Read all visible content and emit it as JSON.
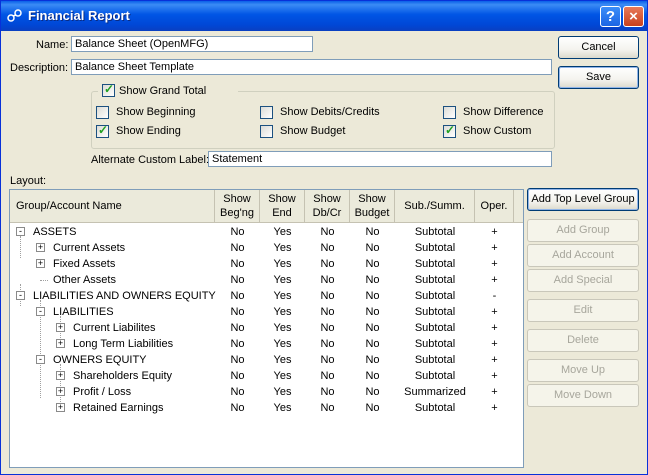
{
  "window": {
    "title": "Financial Report",
    "help_glyph": "?",
    "close_glyph": "×"
  },
  "form": {
    "name_label": "Name:",
    "name_value": "Balance Sheet (OpenMFG)",
    "description_label": "Description:",
    "description_value": "Balance Sheet Template",
    "show_grand_total": "Show Grand Total",
    "show_beginning": "Show Beginning",
    "show_ending": "Show Ending",
    "show_debits_credits": "Show Debits/Credits",
    "show_budget": "Show Budget",
    "show_difference": "Show Difference",
    "show_custom": "Show Custom",
    "alt_custom_label": "Alternate Custom Label:",
    "alt_custom_value": "Statement",
    "layout_label": "Layout:",
    "checked": {
      "show_grand_total": true,
      "show_beginning": false,
      "show_ending": true,
      "show_debits_credits": false,
      "show_budget": false,
      "show_difference": false,
      "show_custom": true
    }
  },
  "buttons": {
    "cancel": "Cancel",
    "save": "Save",
    "add_top_level_group": "Add Top Level Group",
    "add_group": "Add Group",
    "add_account": "Add Account",
    "add_special": "Add Special",
    "edit": "Edit",
    "delete": "Delete",
    "move_up": "Move Up",
    "move_down": "Move Down"
  },
  "table": {
    "columns": [
      {
        "line1": "Group/Account Name",
        "line2": ""
      },
      {
        "line1": "Show",
        "line2": "Beg'ng"
      },
      {
        "line1": "Show",
        "line2": "End"
      },
      {
        "line1": "Show",
        "line2": "Db/Cr"
      },
      {
        "line1": "Show",
        "line2": "Budget"
      },
      {
        "line1": "Sub./Summ.",
        "line2": ""
      },
      {
        "line1": "Oper.",
        "line2": ""
      }
    ],
    "rows": [
      {
        "name": "ASSETS",
        "level": 0,
        "expander": "-",
        "beg": "No",
        "end": "Yes",
        "dbcr": "No",
        "budget": "No",
        "summ": "Subtotal",
        "oper": "+"
      },
      {
        "name": "Current Assets",
        "level": 1,
        "expander": "+",
        "beg": "No",
        "end": "Yes",
        "dbcr": "No",
        "budget": "No",
        "summ": "Subtotal",
        "oper": "+"
      },
      {
        "name": "Fixed Assets",
        "level": 1,
        "expander": "+",
        "beg": "No",
        "end": "Yes",
        "dbcr": "No",
        "budget": "No",
        "summ": "Subtotal",
        "oper": "+"
      },
      {
        "name": "Other Assets",
        "level": 1,
        "expander": "",
        "beg": "No",
        "end": "Yes",
        "dbcr": "No",
        "budget": "No",
        "summ": "Subtotal",
        "oper": "+"
      },
      {
        "name": "LIABILITIES AND OWNERS EQUITY",
        "level": 0,
        "expander": "-",
        "beg": "No",
        "end": "Yes",
        "dbcr": "No",
        "budget": "No",
        "summ": "Subtotal",
        "oper": "-"
      },
      {
        "name": "LIABILITIES",
        "level": 1,
        "expander": "-",
        "beg": "No",
        "end": "Yes",
        "dbcr": "No",
        "budget": "No",
        "summ": "Subtotal",
        "oper": "+"
      },
      {
        "name": "Current Liabilites",
        "level": 2,
        "expander": "+",
        "beg": "No",
        "end": "Yes",
        "dbcr": "No",
        "budget": "No",
        "summ": "Subtotal",
        "oper": "+"
      },
      {
        "name": "Long Term Liabilities",
        "level": 2,
        "expander": "+",
        "beg": "No",
        "end": "Yes",
        "dbcr": "No",
        "budget": "No",
        "summ": "Subtotal",
        "oper": "+"
      },
      {
        "name": "OWNERS EQUITY",
        "level": 1,
        "expander": "-",
        "beg": "No",
        "end": "Yes",
        "dbcr": "No",
        "budget": "No",
        "summ": "Subtotal",
        "oper": "+"
      },
      {
        "name": "Shareholders Equity",
        "level": 2,
        "expander": "+",
        "beg": "No",
        "end": "Yes",
        "dbcr": "No",
        "budget": "No",
        "summ": "Subtotal",
        "oper": "+"
      },
      {
        "name": "Profit / Loss",
        "level": 2,
        "expander": "+",
        "beg": "No",
        "end": "Yes",
        "dbcr": "No",
        "budget": "No",
        "summ": "Summarized",
        "oper": "+"
      },
      {
        "name": "Retained Earnings",
        "level": 2,
        "expander": "+",
        "beg": "No",
        "end": "Yes",
        "dbcr": "No",
        "budget": "No",
        "summ": "Subtotal",
        "oper": "+"
      }
    ]
  }
}
